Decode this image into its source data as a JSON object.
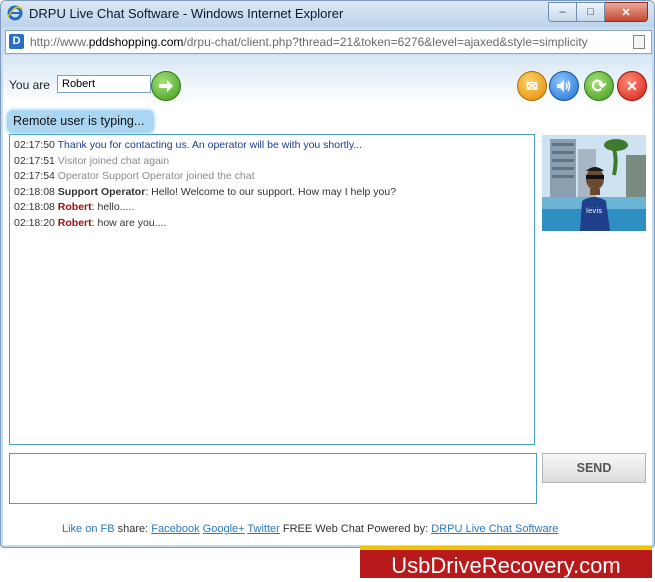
{
  "window": {
    "title": "DRPU Live Chat Software - Windows Internet Explorer",
    "controls": {
      "minimize": "–",
      "maximize": "□",
      "close": "✕"
    }
  },
  "address_bar": {
    "url_prefix": "http://www.",
    "url_domain": "pddshopping.com",
    "url_rest": "/drpu-chat/client.php?thread=21&token=6276&level=ajaxed&style=simplicity",
    "site_icon": "D"
  },
  "header": {
    "you_are_label": "You are",
    "name_value": "Robert",
    "go_icon": "arrow-right",
    "tools": [
      {
        "name": "mail",
        "icon": "✉"
      },
      {
        "name": "sound",
        "icon": "🔊"
      },
      {
        "name": "refresh",
        "icon": "⟳"
      },
      {
        "name": "exit",
        "icon": "✕"
      }
    ]
  },
  "status": {
    "typing_text": "Remote user is typing..."
  },
  "messages": [
    {
      "time": "02:17:50",
      "sender": "",
      "text": "Thank you for contacting us. An operator will be with you shortly...",
      "style": "blue"
    },
    {
      "time": "02:17:51",
      "sender": "",
      "text": "Visitor joined chat again",
      "style": "gray"
    },
    {
      "time": "02:17:54",
      "sender": "",
      "text": "Operator Support Operator joined the chat",
      "style": "gray"
    },
    {
      "time": "02:18:08",
      "sender": "Support Operator",
      "text": ": Hello! Welcome to our support. How may I help you?",
      "style": "operator"
    },
    {
      "time": "02:18:08",
      "sender": "Robert",
      "text": ": hello.....",
      "style": "user"
    },
    {
      "time": "02:18:20",
      "sender": "Robert",
      "text": ": how are you....",
      "style": "user"
    }
  ],
  "compose": {
    "send_label": "SEND",
    "message_value": ""
  },
  "footer": {
    "like_fb": "Like on FB",
    "share_label": " share: ",
    "facebook": "Facebook",
    "google": "Google+",
    "twitter": "Twitter",
    "powered_by": " FREE Web Chat Powered by: ",
    "drpu_link": "DRPU Live Chat Software"
  },
  "watermark": "UsbDriveRecovery.com",
  "colors": {
    "accent_blue": "#4a9fc9",
    "typing_bg": "#aad6f2",
    "user_name": "#a01010",
    "watermark_bg": "#b8191b",
    "watermark_border": "#f0c400"
  }
}
